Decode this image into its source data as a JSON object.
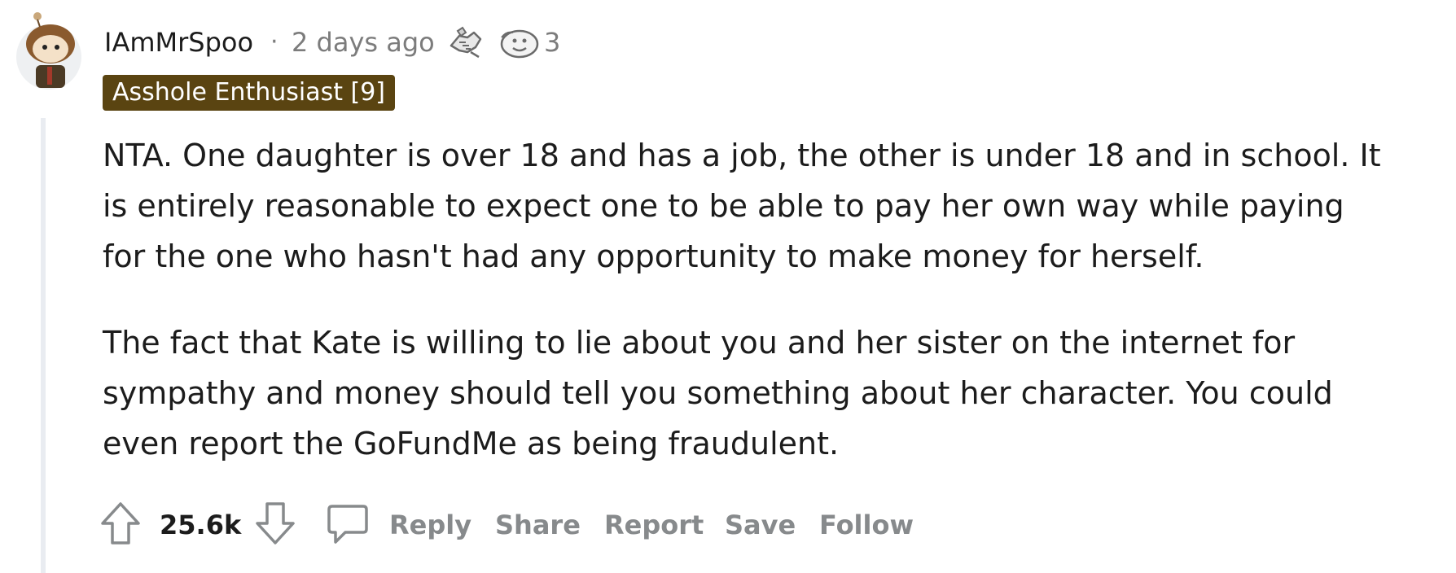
{
  "comment": {
    "author": "IAmMrSpoo",
    "separator": "·",
    "time": "2 days ago",
    "award_count": "3",
    "flair": "Asshole Enthusiast [9]",
    "paragraphs": [
      "NTA. One daughter is over 18 and has a job, the other is under 18 and in school. It\nis entirely reasonable to expect one to be able to pay her own way while paying\nfor the one who hasn't had any opportunity to make money for herself.",
      "The fact that Kate is willing to lie about you and her sister on the internet for\nsympathy and money should tell you something about her character. You could\neven report the GoFundMe as being fraudulent."
    ]
  },
  "actions": {
    "score": "25.6k",
    "reply": "Reply",
    "share": "Share",
    "report": "Report",
    "save": "Save",
    "follow": "Follow"
  },
  "icons": {
    "upvote": "arrow-up-icon",
    "downvote": "arrow-down-icon",
    "comment": "speech-bubble-icon",
    "award1": "handshake-award-icon",
    "award2": "face-award-icon"
  },
  "colors": {
    "flair_bg": "#5a4411",
    "meta_text": "#7c7c7c",
    "action_text": "#878a8c",
    "thread_line": "#e9ecf1"
  }
}
